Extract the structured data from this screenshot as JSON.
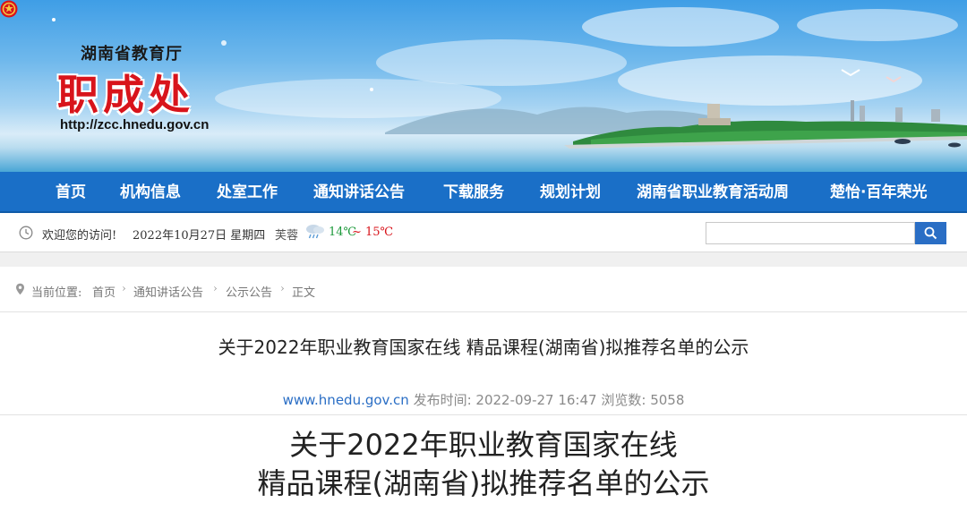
{
  "header": {
    "department": "湖南省教育厅",
    "site_name": "职成处",
    "url": "http://zcc.hnedu.gov.cn"
  },
  "nav": {
    "items": [
      {
        "label": "首页"
      },
      {
        "label": "机构信息"
      },
      {
        "label": "处室工作"
      },
      {
        "label": "通知讲话公告"
      },
      {
        "label": "下载服务"
      },
      {
        "label": "规划计划"
      },
      {
        "label": "湖南省职业教育活动周"
      },
      {
        "label": "楚怡·百年荣光"
      }
    ]
  },
  "infobar": {
    "welcome": "欢迎您的访问!",
    "date": "2022年10月27日 星期四",
    "city": "芙蓉",
    "temp_low": "14℃",
    "temp_sep": "~",
    "temp_high": "15℃",
    "search_placeholder": ""
  },
  "breadcrumb": {
    "prefix": "当前位置:",
    "items": [
      "首页",
      "通知讲话公告",
      "公示公告",
      "正文"
    ]
  },
  "article": {
    "title": "关于2022年职业教育国家在线 精品课程(湖南省)拟推荐名单的公示",
    "source": "www.hnedu.gov.cn",
    "publish_label": "发布时间:",
    "publish_time": "2022-09-27 16:47",
    "views_label": "浏览数:",
    "views": "5058",
    "body_title_line1": "关于2022年职业教育国家在线",
    "body_title_line2": "精品课程(湖南省)拟推荐名单的公示"
  },
  "colors": {
    "nav_bg": "#1a6fc7",
    "site_name": "#d8141b",
    "link": "#2a6ec5"
  }
}
